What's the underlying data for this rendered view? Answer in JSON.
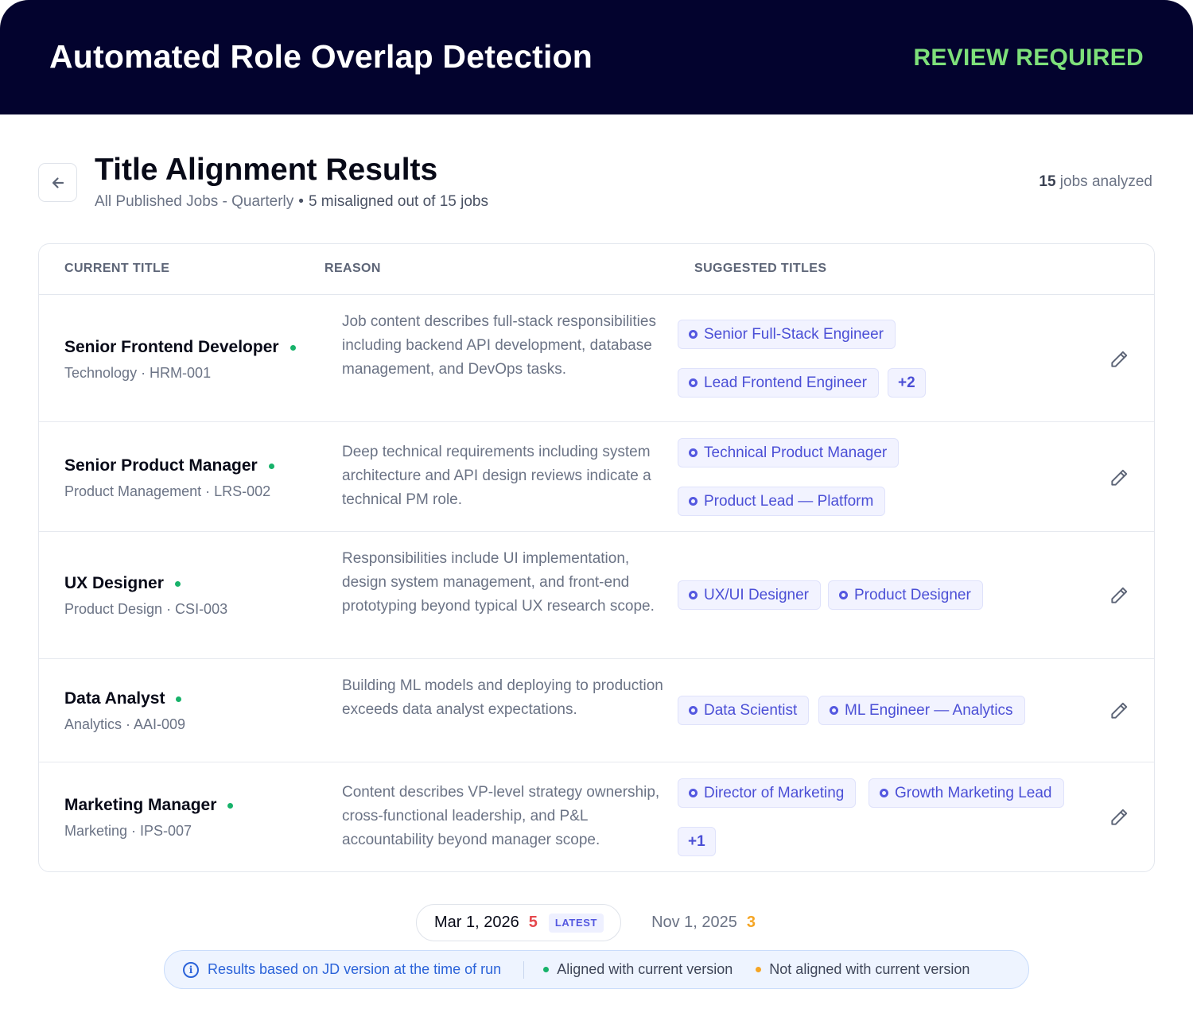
{
  "header": {
    "title": "Automated Role Overlap Detection",
    "status": "REVIEW REQUIRED"
  },
  "page": {
    "title": "Title Alignment Results",
    "scope": "All Published Jobs - Quarterly",
    "separator": "•",
    "misaligned": "5 misaligned out of 15 jobs",
    "jobs_count": "15",
    "jobs_count_suffix": " jobs analyzed"
  },
  "table": {
    "columns": [
      "CURRENT TITLE",
      "REASON",
      "SUGGESTED TITLES"
    ],
    "rows": [
      {
        "title": "Senior Frontend Developer",
        "meta": "Technology · HRM-001",
        "reason": "Job content describes full-stack responsibilities including backend API development, database management, and DevOps tasks.",
        "suggestions": [
          "Senior Full-Stack Engineer",
          "Lead Frontend Engineer"
        ],
        "more": "+2"
      },
      {
        "title": "Senior Product Manager",
        "meta": "Product Management · LRS-002",
        "reason": "Deep technical requirements including system architecture and API design reviews indicate a technical PM role.",
        "suggestions": [
          "Technical Product Manager",
          "Product Lead — Platform"
        ],
        "more": ""
      },
      {
        "title": "UX Designer",
        "meta": "Product Design · CSI-003",
        "reason": "Responsibilities include UI implementation, design system management, and front-end prototyping beyond typical UX research scope.",
        "suggestions": [
          "UX/UI Designer",
          "Product Designer"
        ],
        "more": ""
      },
      {
        "title": "Data Analyst",
        "meta": "Analytics · AAI-009",
        "reason": "Building ML models and deploying to production exceeds data analyst expectations.",
        "suggestions": [
          "Data Scientist",
          "ML Engineer — Analytics"
        ],
        "more": ""
      },
      {
        "title": "Marketing Manager",
        "meta": "Marketing · IPS-007",
        "reason": "Content describes VP-level strategy ownership, cross-functional leadership, and P&L accountability beyond manager scope.",
        "suggestions": [
          "Director of Marketing",
          "Growth Marketing Lead"
        ],
        "more": "+1"
      }
    ]
  },
  "versions": {
    "active": {
      "date": "Mar 1, 2026",
      "count": "5",
      "badge": "LATEST"
    },
    "previous": {
      "date": "Nov 1, 2025",
      "count": "3"
    }
  },
  "legend": {
    "info": "Results based on JD version at the time of run",
    "aligned": "Aligned with current version",
    "not_aligned": "Not aligned with current version"
  },
  "colors": {
    "header_bg": "#03032e",
    "status": "#7ee07a",
    "accent": "#4b4fd6",
    "aligned_dot": "#17b26a",
    "not_aligned_dot": "#f5a524",
    "latest_count": "#e5484d"
  }
}
